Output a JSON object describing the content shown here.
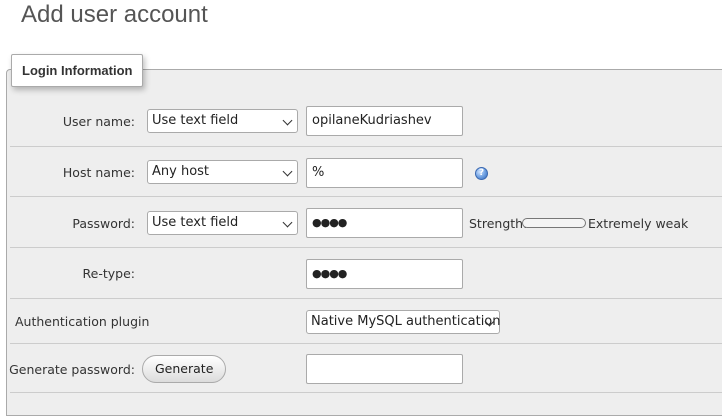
{
  "page": {
    "title": "Add user account"
  },
  "fieldset": {
    "legend": "Login Information"
  },
  "rows": {
    "username": {
      "label": "User name:",
      "select_value": "Use text field",
      "input_value": "opilaneKudriashev"
    },
    "hostname": {
      "label": "Host name:",
      "select_value": "Any host",
      "input_value": "%",
      "help_icon": "info-icon"
    },
    "password": {
      "label": "Password:",
      "select_value": "Use text field",
      "input_value": "●●●●",
      "strength_label": "Strength:",
      "strength_value": "Extremely weak",
      "strength_level": 0
    },
    "retype": {
      "label": "Re-type:",
      "input_value": "●●●●"
    },
    "auth_plugin": {
      "label": "Authentication plugin",
      "select_value": "Native MySQL authentication"
    },
    "generate": {
      "label": "Generate password:",
      "button_label": "Generate",
      "input_value": ""
    }
  },
  "colors": {
    "panel_bg": "#eeeeee",
    "border": "#aaaaaa",
    "help_icon": "#6a9de0"
  }
}
